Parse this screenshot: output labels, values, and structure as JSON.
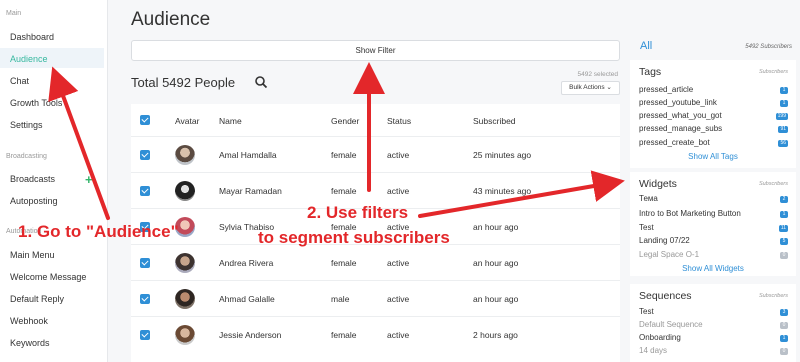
{
  "sidebar": {
    "sections": [
      "Main",
      "Broadcasting",
      "Automation"
    ],
    "items": [
      "Dashboard",
      "Audience",
      "Chat",
      "Growth Tools",
      "Settings",
      "Broadcasts",
      "Autoposting",
      "Main Menu",
      "Welcome Message",
      "Default Reply",
      "Webhook",
      "Keywords"
    ]
  },
  "main": {
    "title": "Audience",
    "show_filter_label": "Show Filter",
    "total": "Total 5492 People",
    "selected_count": "5492 selected",
    "bulk_actions_label": "Bulk Actions ⌄"
  },
  "table": {
    "headers": [
      "Avatar",
      "Name",
      "Gender",
      "Status",
      "Subscribed"
    ],
    "rows": [
      {
        "name": "Amal Hamdalla",
        "gender": "female",
        "status": "active",
        "subscribed": "25 minutes ago"
      },
      {
        "name": "Mayar Ramadan",
        "gender": "female",
        "status": "active",
        "subscribed": "43 minutes ago"
      },
      {
        "name": "Sylvia Thabiso",
        "gender": "female",
        "status": "active",
        "subscribed": "an hour ago"
      },
      {
        "name": "Andrea Rivera",
        "gender": "female",
        "status": "active",
        "subscribed": "an hour ago"
      },
      {
        "name": "Ahmad Galalle",
        "gender": "male",
        "status": "active",
        "subscribed": "an hour ago"
      },
      {
        "name": "Jessie Anderson",
        "gender": "female",
        "status": "active",
        "subscribed": "2 hours ago"
      }
    ]
  },
  "right": {
    "all_label": "All",
    "all_count": "5492 Subscribers",
    "tags": {
      "title": "Tags",
      "subtitle": "Subscribers",
      "items": [
        {
          "label": "pressed_article",
          "count": "1"
        },
        {
          "label": "pressed_youtube_link",
          "count": "1"
        },
        {
          "label": "pressed_what_you_got",
          "count": "199"
        },
        {
          "label": "pressed_manage_subs",
          "count": "91"
        },
        {
          "label": "pressed_create_bot",
          "count": "56"
        }
      ],
      "link": "Show All Tags"
    },
    "widgets": {
      "title": "Widgets",
      "subtitle": "Subscribers",
      "items": [
        {
          "label": "Тема",
          "count": "2"
        },
        {
          "label": "Intro to Bot Marketing Button",
          "count": "1"
        },
        {
          "label": "Test",
          "count": "11"
        },
        {
          "label": "Landing 07/22",
          "count": "5"
        },
        {
          "label": "Legal Space O-1",
          "count": "0"
        }
      ],
      "link": "Show All Widgets"
    },
    "sequences": {
      "title": "Sequences",
      "subtitle": "Subscribers",
      "items": [
        {
          "label": "Test",
          "count": "3"
        },
        {
          "label": "Default Sequence",
          "count": "0"
        },
        {
          "label": "Onboarding",
          "count": "1"
        },
        {
          "label": "14 days",
          "count": "0"
        }
      ]
    }
  },
  "annotations": {
    "step1": "1. Go to \"Audience\"",
    "step2_line1": "2. Use filters",
    "step2_line2": "to segment subscribers",
    "color": "#e3272a"
  }
}
